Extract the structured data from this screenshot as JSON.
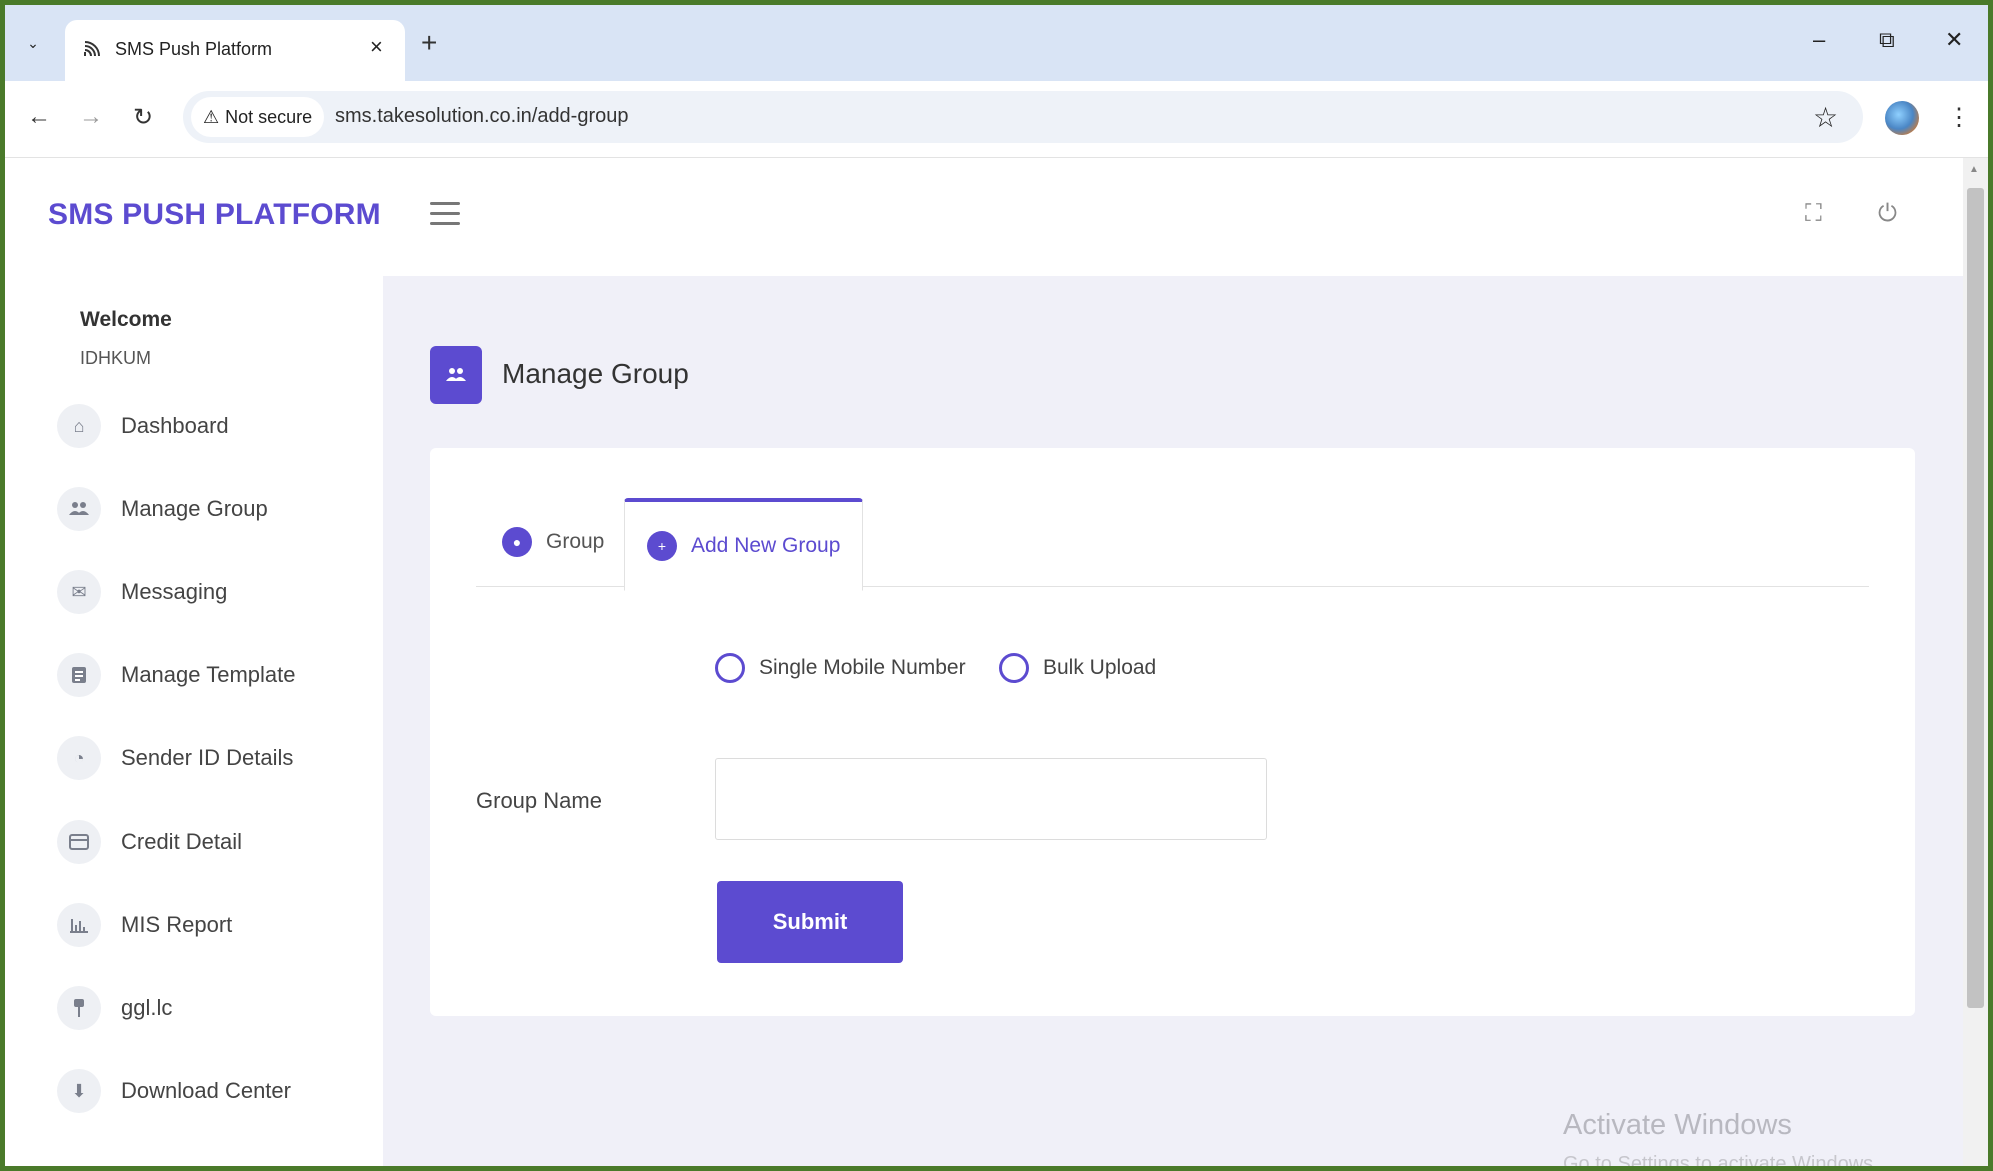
{
  "browser": {
    "tab_title": "SMS Push Platform",
    "tab_close": "×",
    "new_tab": "+",
    "security_label": "Not secure",
    "url": "sms.takesolution.co.in/add-group",
    "minimize": "–",
    "restore": "⧉",
    "close": "✕"
  },
  "app": {
    "brand": "SMS PUSH PLATFORM",
    "accent_color": "#5c4bd0"
  },
  "sidebar": {
    "welcome": "Welcome",
    "username": "IDHKUM",
    "items": [
      {
        "label": "Dashboard",
        "icon": "home-icon"
      },
      {
        "label": "Manage Group",
        "icon": "users-icon"
      },
      {
        "label": "Messaging",
        "icon": "mail-icon"
      },
      {
        "label": "Manage Template",
        "icon": "document-icon"
      },
      {
        "label": "Sender ID Details",
        "icon": "sender-icon"
      },
      {
        "label": "Credit Detail",
        "icon": "card-icon"
      },
      {
        "label": "MIS Report",
        "icon": "bar-chart-icon"
      },
      {
        "label": "ggl.lc",
        "icon": "pin-icon"
      },
      {
        "label": "Download Center",
        "icon": "download-icon"
      }
    ]
  },
  "page": {
    "title": "Manage Group",
    "tabs": [
      {
        "label": "Group",
        "active": false
      },
      {
        "label": "Add New Group",
        "active": true
      }
    ],
    "radio_options": [
      "Single Mobile Number",
      "Bulk Upload"
    ],
    "field_label": "Group Name",
    "field_value": "",
    "submit_label": "Submit"
  },
  "watermark": {
    "line1": "Activate Windows",
    "line2": "Go to Settings to activate Windows."
  }
}
